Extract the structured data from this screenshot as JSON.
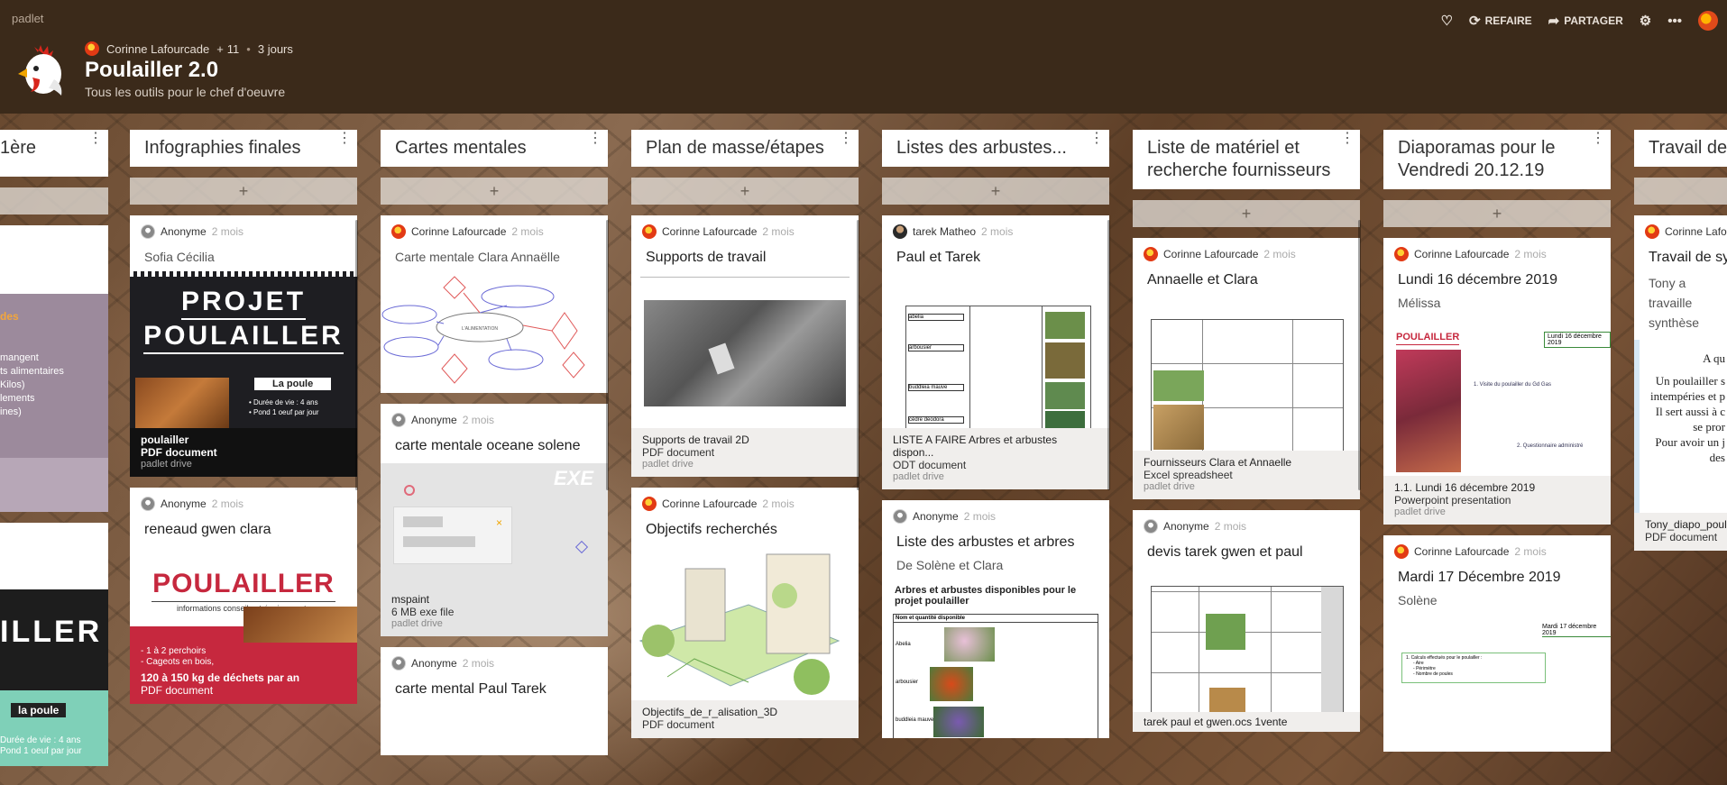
{
  "app": {
    "brand": "padlet"
  },
  "actions": {
    "redo": "REFAIRE",
    "share": "PARTAGER"
  },
  "board": {
    "author": "Corinne Lafourcade",
    "plus": "+",
    "contributors": "11",
    "age": "3 jours",
    "title": "Poulailler 2.0",
    "subtitle": "Tous les outils pour le chef d'oeuvre"
  },
  "poster": {
    "projet_line1": "PROJET",
    "projet_line2": "POULAILLER",
    "la_poule": "La poule",
    "bullet1": "Durée de vie : 4 ans",
    "bullet2": "Pond 1 oeuf par jour",
    "poulailler_big": "POULAILLER",
    "poulailler_small": "informations conseils et équipements",
    "perchoirs1": "- 1 à 2 perchoirs",
    "perchoirs2": "- Cageots en bois,",
    "left_frag1": "des",
    "left_frag2": "mangent",
    "left_frag3": "ts alimentaires",
    "left_frag4": "Kilos)",
    "left_frag5": "lements",
    "left_frag6": "ines)",
    "left_big": "ILLER",
    "left_poule": "la poule",
    "left_duree": "Durée de vie : 4 ans",
    "left_pond": "Pond 1 oeuf par jour"
  },
  "columns": [
    {
      "title": "1ère"
    },
    {
      "title": "Infographies finales"
    },
    {
      "title": "Cartes mentales"
    },
    {
      "title": "Plan de masse/étapes"
    },
    {
      "title": "Listes des arbustes..."
    },
    {
      "title": "Liste de matériel et recherche fournisseurs"
    },
    {
      "title": "Diaporamas pour le Vendredi 20.12.19"
    },
    {
      "title": "Travail de sy"
    }
  ],
  "cards": {
    "c1a": {
      "author": "Anonyme",
      "time": "2 mois",
      "title": "Sofia Cécilia",
      "file": "poulailler",
      "type": "PDF document",
      "source": "padlet drive"
    },
    "c1b": {
      "author": "Anonyme",
      "time": "2 mois",
      "title": "reneaud gwen clara",
      "file": "120 à 150 kg de déchets par an",
      "type": "PDF document"
    },
    "c2a": {
      "author": "Corinne Lafourcade",
      "time": "2 mois",
      "title": "Carte mentale Clara Annaëlle",
      "center": "L'ALIMENTATION"
    },
    "c2b": {
      "author": "Anonyme",
      "time": "2 mois",
      "title": "carte mentale oceane solene",
      "file": "mspaint",
      "type": "6 MB exe file",
      "source": "padlet drive",
      "badge": "EXE"
    },
    "c2c": {
      "author": "Anonyme",
      "time": "2 mois",
      "title": "carte mental Paul Tarek"
    },
    "c3a": {
      "author": "Corinne Lafourcade",
      "time": "2 mois",
      "title": "Supports de travail",
      "file": "Supports de travail 2D",
      "type": "PDF document",
      "source": "padlet drive"
    },
    "c3b": {
      "author": "Corinne Lafourcade",
      "time": "2 mois",
      "title": "Objectifs recherchés",
      "file": "Objectifs_de_r_alisation_3D",
      "type": "PDF document"
    },
    "c4a": {
      "author": "tarek Matheo",
      "time": "2 mois",
      "title": "Paul et Tarek",
      "file": "LISTE A FAIRE Arbres et arbustes dispon...",
      "type": "ODT document",
      "source": "padlet drive",
      "row1": "abelia",
      "row2": "arbousier",
      "row3": "buddleia mauve",
      "row4": "cèdre deodora"
    },
    "c4b": {
      "author": "Anonyme",
      "time": "2 mois",
      "title": "Liste des arbustes et arbres",
      "sub": "De Solène et Clara",
      "doc_title": "Arbres et arbustes disponibles pour le projet poulailler",
      "doc_head": "Nom et quantité disponible",
      "r1": "Abelia",
      "r2": "arbousier",
      "r3": "buddleia mauve"
    },
    "c5a": {
      "author": "Corinne Lafourcade",
      "time": "2 mois",
      "title": "Annaelle et Clara",
      "file": "Fournisseurs Clara et Annaelle",
      "type": "Excel spreadsheet",
      "source": "padlet drive"
    },
    "c5b": {
      "author": "Anonyme",
      "time": "2 mois",
      "title": "devis tarek gwen et paul",
      "file": "tarek paul et gwen.ocs 1vente"
    },
    "c6a": {
      "author": "Corinne Lafourcade",
      "time": "2 mois",
      "title": "Lundi 16 décembre 2019",
      "sub": "Mélissa",
      "file": "1.1. Lundi 16 décembre 2019",
      "type": "Powerpoint presentation",
      "source": "padlet drive",
      "slide_title": "POULAILLER",
      "slide_date": "Lundi 16 décembre 2019",
      "slide_item1": "1. Visite du poulailler du Gd Gas",
      "slide_item2": "2. Questionnaire administré"
    },
    "c6b": {
      "author": "Corinne Lafourcade",
      "time": "2 mois",
      "title": "Mardi 17 Décembre 2019",
      "sub": "Solène",
      "slide_date": "Mardi 17 décembre 2019",
      "li1": "Calculs effectués pour le poulailler :",
      "li2": "Aire",
      "li3": "Périmètre",
      "li4": "Nombre de poules"
    },
    "c7a": {
      "author": "Corinne Lafou",
      "title": "Travail de sy",
      "sub": "Tony a travaille synthèse",
      "file": "Tony_diapo_poul",
      "type": "PDF document",
      "frag1": "A qu",
      "frag2": "Un poulailler s",
      "frag3": "intempéries et p",
      "frag4": "Il sert aussi à c",
      "frag5": "se pror",
      "frag6": "Pour avoir un j",
      "frag7": "des"
    }
  },
  "colors": {
    "header": "#3b2a1a",
    "accent_red": "#c6283e"
  }
}
